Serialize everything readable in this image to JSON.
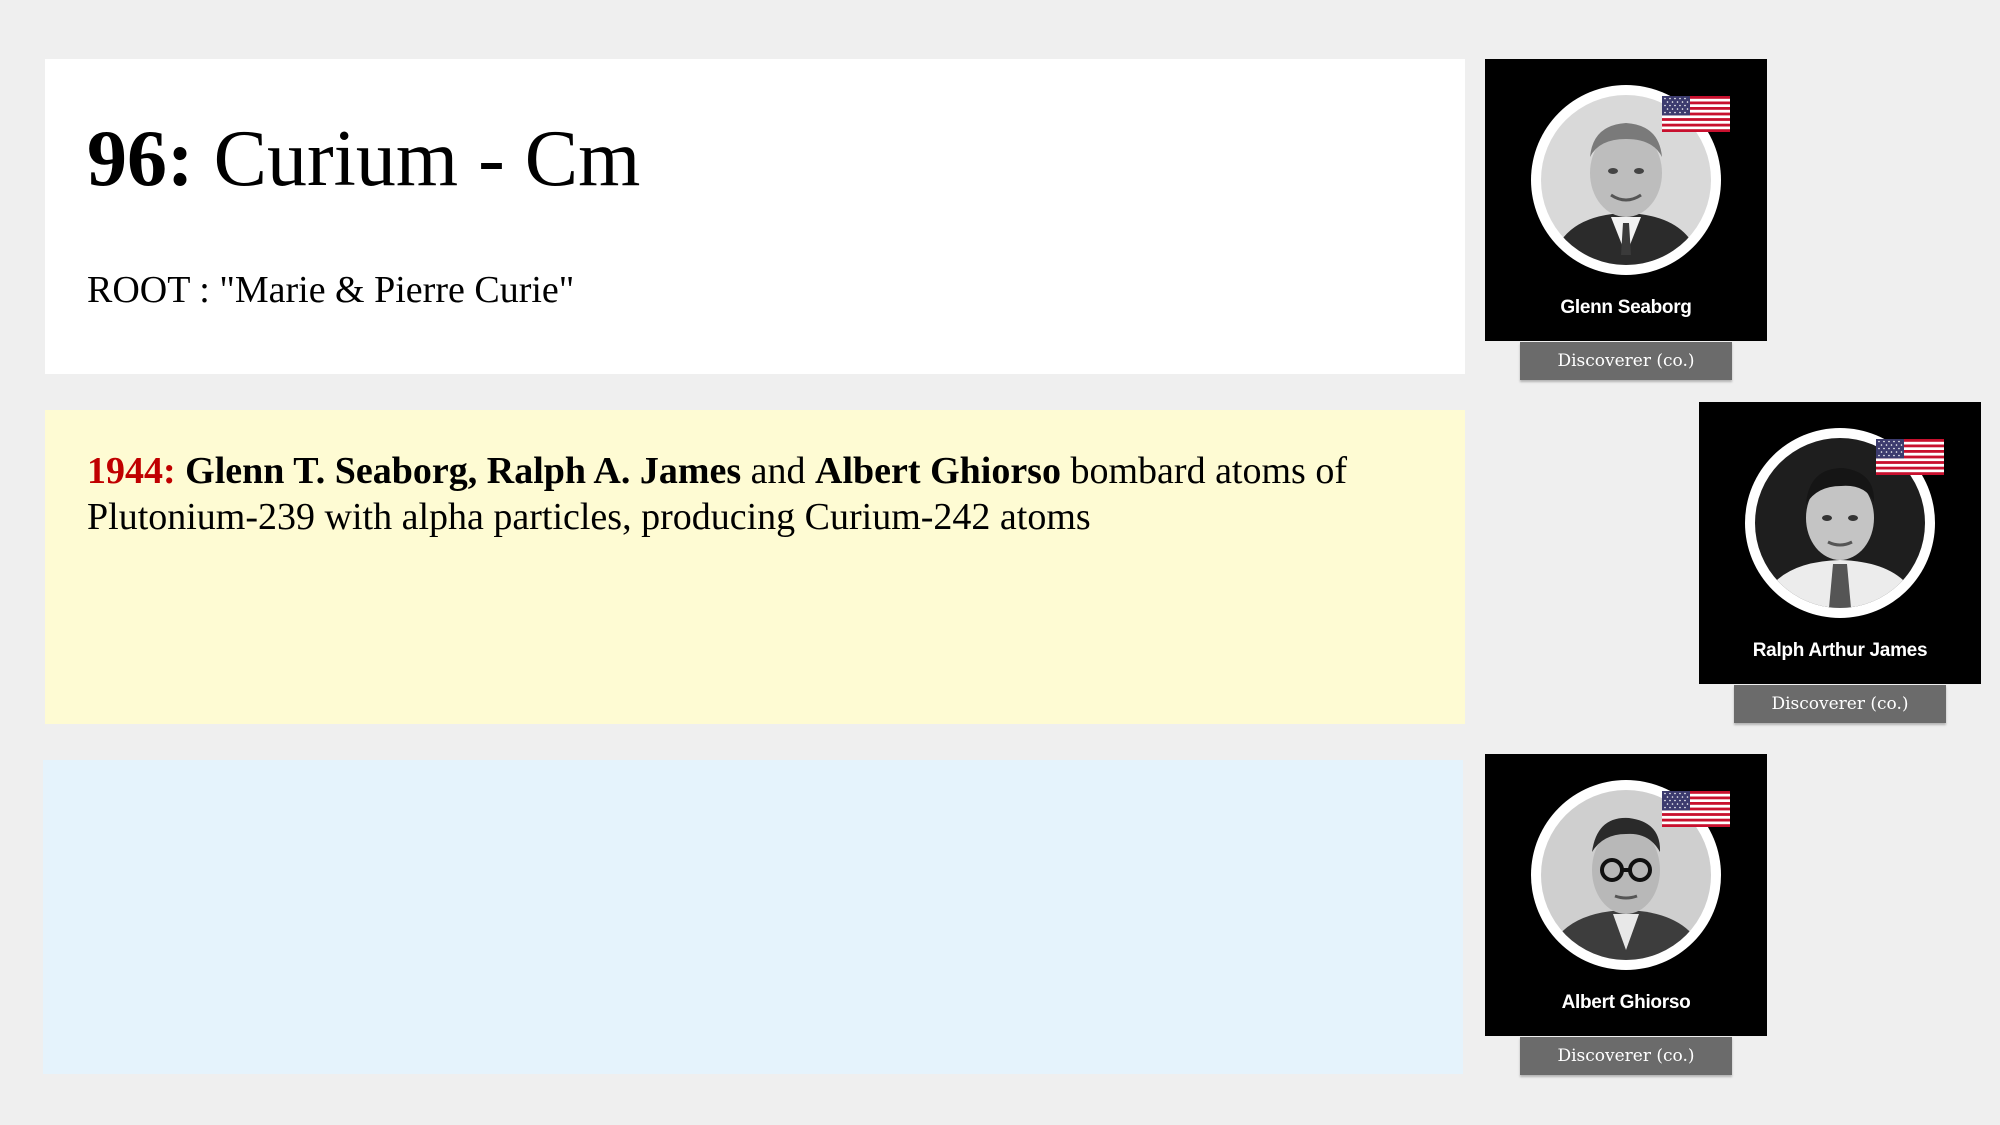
{
  "title": {
    "number": "96:",
    "name": "Curium - Cm"
  },
  "root": "ROOT : \"Marie & Pierre Curie\"",
  "event": {
    "year": "1944:",
    "person1": "Glenn T. Seaborg,",
    "person2": "Ralph A. James",
    "conj": "and",
    "person3": "Albert Ghiorso",
    "rest": "bombard atoms of Plutonium-239 with alpha particles, producing Curium-242 atoms"
  },
  "discoverers": [
    {
      "name": "Glenn Seaborg",
      "role": "Discoverer (co.)",
      "flag": "usa-flag-icon"
    },
    {
      "name": "Ralph Arthur James",
      "role": "Discoverer (co.)",
      "flag": "usa-flag-icon"
    },
    {
      "name": "Albert Ghiorso",
      "role": "Discoverer (co.)",
      "flag": "usa-flag-icon"
    }
  ],
  "colors": {
    "background": "#efefef",
    "title_panel": "#ffffff",
    "event_panel": "#fefbd3",
    "empty_panel": "#e5f3fc",
    "year_accent": "#c00000",
    "badge": "#6b6b6b"
  }
}
